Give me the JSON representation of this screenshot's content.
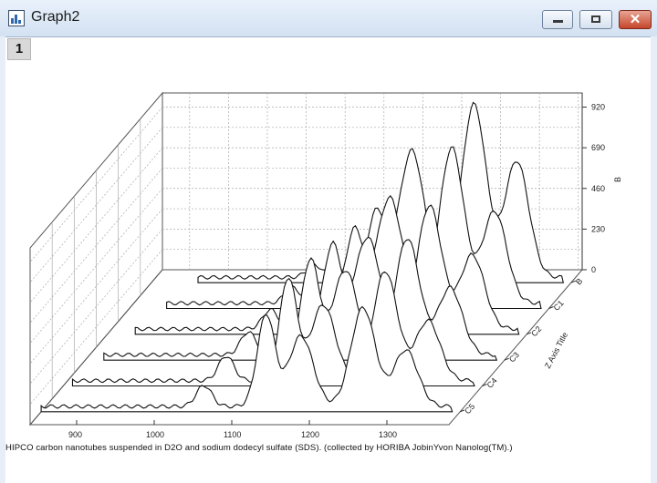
{
  "window": {
    "title": "Graph2",
    "layer_label": "1",
    "close_glyph": "✕"
  },
  "chart_data": {
    "type": "line",
    "title": "",
    "caption": "HIPCO carbon nanotubes suspended in D2O and sodium dodecyl sulfate (SDS). (collected by HORIBA JobinYvon Nanolog(TM).)",
    "xlabel": "",
    "ylabel": "Z Axis Title",
    "zlabel": "B",
    "x_ticks": [
      "900",
      "1000",
      "1100",
      "1200",
      "1300"
    ],
    "z_ticks": [
      "0",
      "230",
      "460",
      "690",
      "920"
    ],
    "y_ticks": [
      "B",
      "C1",
      "C2",
      "C3",
      "C4",
      "C5"
    ],
    "xlim": [
      840,
      1380
    ],
    "zlim": [
      0,
      1050
    ],
    "grid": true,
    "series": [
      {
        "name": "C5",
        "peaks": [
          [
            1050,
            120,
            14
          ],
          [
            1130,
            520,
            16
          ],
          [
            1175,
            400,
            22
          ],
          [
            1255,
            560,
            22
          ],
          [
            1310,
            320,
            22
          ]
        ],
        "baseline": 30
      },
      {
        "name": "C4",
        "peaks": [
          [
            1050,
            140,
            14
          ],
          [
            1130,
            580,
            16
          ],
          [
            1175,
            430,
            22
          ],
          [
            1255,
            620,
            22
          ],
          [
            1310,
            340,
            22
          ]
        ],
        "baseline": 30
      },
      {
        "name": "C3",
        "peaks": [
          [
            1050,
            130,
            14
          ],
          [
            1130,
            540,
            16
          ],
          [
            1175,
            480,
            22
          ],
          [
            1255,
            660,
            22
          ],
          [
            1310,
            380,
            22
          ]
        ],
        "baseline": 30
      },
      {
        "name": "C2",
        "peaks": [
          [
            1050,
            110,
            14
          ],
          [
            1130,
            480,
            16
          ],
          [
            1175,
            520,
            22
          ],
          [
            1255,
            700,
            22
          ],
          [
            1310,
            420,
            22
          ]
        ],
        "baseline": 30
      },
      {
        "name": "C1",
        "peaks": [
          [
            1050,
            90,
            14
          ],
          [
            1130,
            420,
            16
          ],
          [
            1175,
            600,
            22
          ],
          [
            1255,
            880,
            22
          ],
          [
            1310,
            520,
            22
          ]
        ],
        "baseline": 30
      },
      {
        "name": "B",
        "peaks": [
          [
            1050,
            70,
            14
          ],
          [
            1130,
            380,
            16
          ],
          [
            1175,
            720,
            22
          ],
          [
            1255,
            980,
            22
          ],
          [
            1310,
            660,
            22
          ]
        ],
        "baseline": 30
      }
    ]
  }
}
